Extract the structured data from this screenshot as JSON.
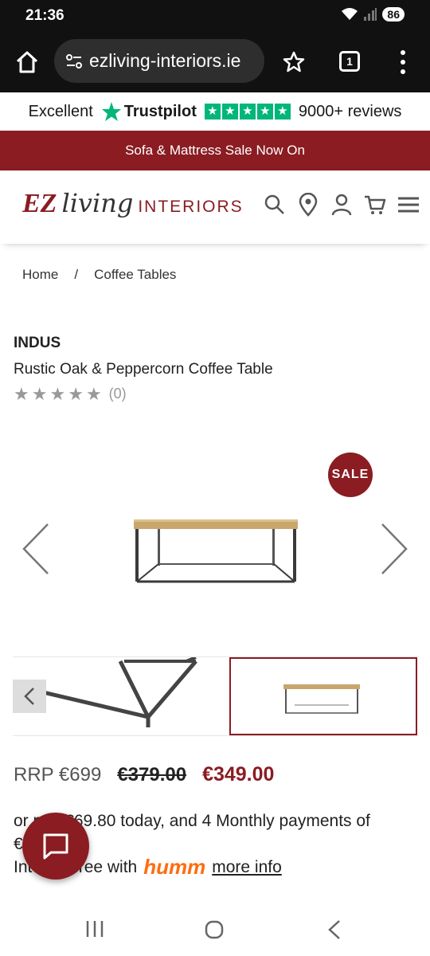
{
  "status": {
    "time": "21:36",
    "battery": "86"
  },
  "browser": {
    "url": "ezliving-interiors.ie",
    "tab_count": "1"
  },
  "trustbar": {
    "rating_word": "Excellent",
    "brand": "Trustpilot",
    "reviews": "9000+ reviews"
  },
  "banner": {
    "text": "Sofa & Mattress Sale Now On"
  },
  "site": {
    "logo_ez": "EZ",
    "logo_living": "living",
    "logo_interiors": "INTERIORS"
  },
  "breadcrumb": {
    "home": "Home",
    "separator": "/",
    "current": "Coffee Tables"
  },
  "product": {
    "brand": "INDUS",
    "name": "Rustic Oak & Peppercorn Coffee Table",
    "review_count": "(0)",
    "sale_badge": "SALE",
    "rrp": "RRP €699",
    "was_price": "€379.00",
    "now_price": "€349.00"
  },
  "finance": {
    "line1": "or pay €69.80 today, and 4 Monthly payments of",
    "line2": "€",
    "line3_start": "Interest free with",
    "provider": "humm",
    "more_info": "more info"
  },
  "colors": {
    "brand_red": "#8a1c22",
    "trustpilot_green": "#00b67a",
    "humm_orange": "#ff6c0e"
  }
}
